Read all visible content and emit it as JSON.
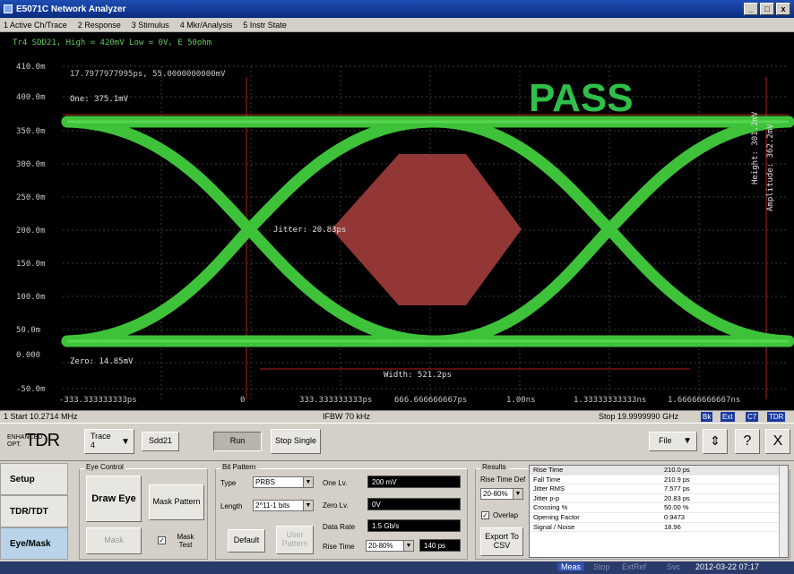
{
  "window": {
    "title": "E5071C Network Analyzer",
    "buttons": [
      "_",
      "□",
      "x"
    ]
  },
  "menu": [
    "1 Active Ch/Trace",
    "2 Response",
    "3 Stimulus",
    "4 Mkr/Analysis",
    "5 Instr State"
  ],
  "scope": {
    "top_readout": "Tr4 SDD21, High = 420mV Low = 0V, E 50ohm",
    "marker_readout": "17.7977977995ps, 55.0000000000mV",
    "pass_label": "PASS",
    "one_level": "One: 375.1mV",
    "zero_level": "Zero: 14.85mV",
    "jitter": "Jitter: 20.83ps",
    "width": "Width: 521.2ps",
    "height_v": "Height: 301.2mV",
    "amplitude_v": "Amplitude: 362.2mV",
    "y_ticks": [
      "410.0m",
      "400.0m",
      "350.0m",
      "300.0m",
      "250.0m",
      "200.0m",
      "150.0m",
      "100.0m",
      "50.0m",
      "0.000",
      "-50.0m"
    ],
    "x_ticks": [
      "-333.333333333ps",
      "0",
      "333.333333333ps",
      "666.666666667ps",
      "1.00ns",
      "1.33333333333ns",
      "1.66666666667ns"
    ],
    "colors": {
      "eye": "#3ec23a",
      "mask": "#9e3b3b",
      "background": "#000000",
      "pass": "#2fbf4a",
      "marker": "#c02020"
    }
  },
  "freqbar": {
    "start": "1 Start 10.2714 MHz",
    "ifbw": "IFBW 70 kHz",
    "stop": "Stop 19.9999990 GHz",
    "tags": [
      "Bk",
      "Ext",
      "C7",
      "TDR"
    ]
  },
  "toolbar": {
    "logo_small": "ENHANCED OPT.",
    "logo_big": "TDR",
    "trace_label": "Trace",
    "trace_value": "4",
    "param": "Sdd21",
    "run": "Run",
    "stop_single": "Stop Single",
    "file": "File",
    "help": "?",
    "close": "X"
  },
  "tabs": [
    "Setup",
    "TDR/TDT",
    "Eye/Mask"
  ],
  "eye_control": {
    "title": "Eye Control",
    "draw_eye": "Draw Eye",
    "mask_pattern": "Mask Pattern",
    "mask_btn": "Mask",
    "mask_test": "Mask Test",
    "mask_test_checked": true
  },
  "bit_pattern": {
    "title": "Bit Pattern",
    "type_label": "Type",
    "type_value": "PRBS",
    "length_label": "Length",
    "length_value": "2^11-1 bits",
    "one_lv_label": "One Lv.",
    "one_lv_value": "200 mV",
    "zero_lv_label": "Zero Lv.",
    "zero_lv_value": "0V",
    "data_rate_label": "Data Rate",
    "data_rate_value": "1.5 Gb/s",
    "rise_time_label": "Rise Time",
    "rise_time_mode": "20-80%",
    "rise_time_value": "140 ps",
    "default_btn": "Default",
    "user_pattern_btn": "User Pattern"
  },
  "results": {
    "title": "Results",
    "rise_time_def_label": "Rise Time Def",
    "rise_time_def_value": "20-80%",
    "overlap_label": "Overlap",
    "overlap_checked": true,
    "export_btn": "Export To CSV",
    "rows": [
      {
        "name": "Rise Time",
        "value": "210.0 ps"
      },
      {
        "name": "Fall Time",
        "value": "210.9 ps"
      },
      {
        "name": "Jitter RMS",
        "value": "7.577 ps"
      },
      {
        "name": "Jitter p-p",
        "value": "20.83 ps"
      },
      {
        "name": "Crossing %",
        "value": "50.00 %"
      },
      {
        "name": "Opening Factor",
        "value": "0.9473"
      },
      {
        "name": "Signal / Noise",
        "value": "18.96"
      }
    ]
  },
  "taskbar": {
    "meas": "Meas",
    "items": [
      "Stop",
      "ExtRef",
      "Svc"
    ],
    "datetime": "2012-03-22 07:17"
  }
}
